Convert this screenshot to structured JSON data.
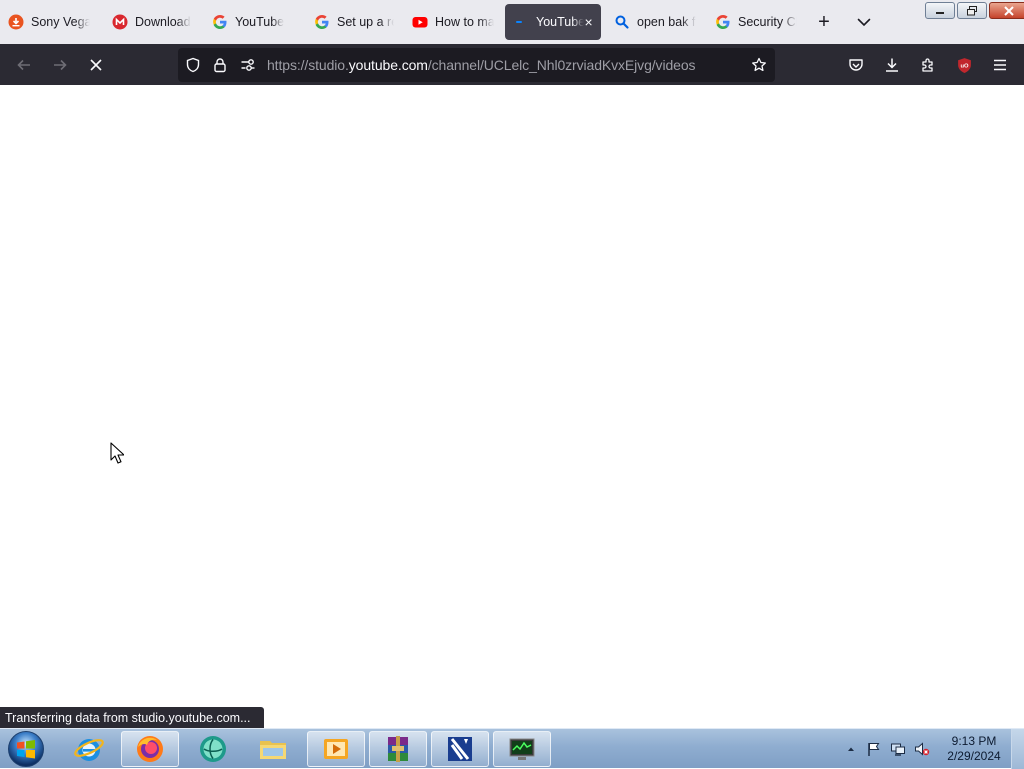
{
  "browser": {
    "tabs": [
      {
        "title": "Sony Vegas Pro",
        "icon": "sony-favicon",
        "active": false
      },
      {
        "title": "Download",
        "icon": "mega-favicon",
        "active": false
      },
      {
        "title": "YouTube",
        "icon": "google-favicon",
        "active": false
      },
      {
        "title": "Set up a rece",
        "icon": "google-favicon",
        "active": false
      },
      {
        "title": "How to make",
        "icon": "youtube-favicon",
        "active": false
      },
      {
        "title": "YouTube Studio",
        "icon": "loading-favicon",
        "active": true,
        "close_label": "×"
      },
      {
        "title": "open bak file",
        "icon": "search-favicon",
        "active": false
      },
      {
        "title": "Security Check",
        "icon": "google-favicon",
        "active": false
      }
    ],
    "new_tab_label": "+",
    "list_tabs_label": "⌄",
    "url": {
      "prefix": "https://studio.",
      "host": "youtube.com",
      "path": "/channel/UCLelc_Nhl0zrviadKvxEjvg/videos"
    },
    "status_text": "Transferring data from studio.youtube.com..."
  },
  "taskbar": {
    "apps": [
      {
        "name": "internet-explorer",
        "open": false
      },
      {
        "name": "firefox",
        "open": true
      },
      {
        "name": "globe-app",
        "open": false
      },
      {
        "name": "file-explorer",
        "open": false
      },
      {
        "name": "media-player",
        "open": true
      },
      {
        "name": "winrar",
        "open": true
      },
      {
        "name": "video-editor",
        "open": true
      },
      {
        "name": "system-monitor",
        "open": true
      }
    ],
    "clock": {
      "time": "9:13 PM",
      "date": "2/29/2024"
    }
  },
  "colors": {
    "accent": "#0060df",
    "nav_bg": "#2b2a33",
    "url_bg": "#1c1b22",
    "tabstrip_bg": "#eaeaef",
    "active_tab_bg": "#42414d",
    "ublock_red": "#c1272d"
  }
}
